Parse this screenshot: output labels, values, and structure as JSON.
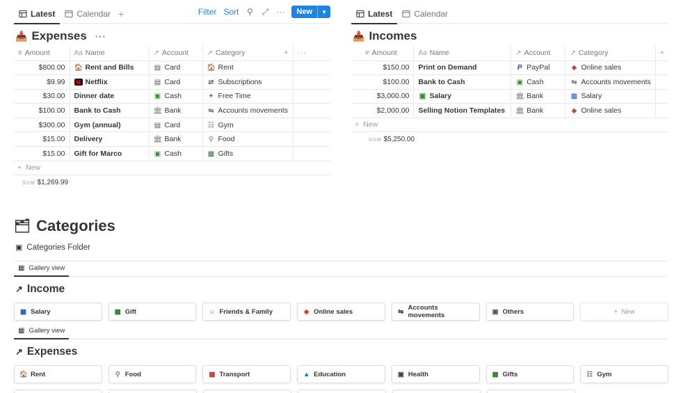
{
  "left_panel": {
    "tabs": [
      {
        "label": "Latest"
      },
      {
        "label": "Calendar"
      }
    ],
    "toolbar": {
      "filter": "Filter",
      "sort": "Sort",
      "new": "New"
    },
    "title": "Expenses",
    "columns": {
      "amount": "Amount",
      "name": "Name",
      "account": "Account",
      "category": "Category"
    },
    "rows": [
      {
        "amount": "$800.00",
        "name": "Rent and Bills",
        "name_icon": "house-icon",
        "account": "Card",
        "account_icon": "card-icon",
        "category": "Rent",
        "category_icon": "house-icon"
      },
      {
        "amount": "$9.99",
        "name": "Netflix",
        "name_icon": "netflix-icon",
        "account": "Card",
        "account_icon": "card-icon",
        "category": "Subscriptions",
        "category_icon": "repeat-icon"
      },
      {
        "amount": "$30.00",
        "name": "Dinner date",
        "name_icon": "",
        "account": "Cash",
        "account_icon": "cash-icon",
        "category": "Free Time",
        "category_icon": "confetti-icon"
      },
      {
        "amount": "$100.00",
        "name": "Bank to Cash",
        "name_icon": "",
        "account": "Bank",
        "account_icon": "bank-icon",
        "category": "Accounts movements",
        "category_icon": "exchange-icon"
      },
      {
        "amount": "$300.00",
        "name": "Gym (annual)",
        "name_icon": "",
        "account": "Card",
        "account_icon": "card-icon",
        "category": "Gym",
        "category_icon": "dumbbell-icon"
      },
      {
        "amount": "$15.00",
        "name": "Delivery",
        "name_icon": "",
        "account": "Bank",
        "account_icon": "bank-icon",
        "category": "Food",
        "category_icon": "fork-knife-icon"
      },
      {
        "amount": "$15.00",
        "name": "Gift for Marco",
        "name_icon": "",
        "account": "Cash",
        "account_icon": "cash-icon",
        "category": "Gifts",
        "category_icon": "gift-icon"
      }
    ],
    "new_row": "New",
    "sum_label": "SUM",
    "sum_value": "$1,269.99"
  },
  "right_panel": {
    "tabs": [
      {
        "label": "Latest"
      },
      {
        "label": "Calendar"
      }
    ],
    "title": "Incomes",
    "columns": {
      "amount": "Amount",
      "name": "Name",
      "account": "Account",
      "category": "Category"
    },
    "rows": [
      {
        "amount": "$150.00",
        "name": "Print on Demand",
        "name_icon": "",
        "account": "PayPal",
        "account_icon": "paypal-icon",
        "category": "Online sales",
        "category_icon": "tag-icon"
      },
      {
        "amount": "$100.00",
        "name": "Bank to Cash",
        "name_icon": "",
        "account": "Cash",
        "account_icon": "cash-icon",
        "category": "Accounts movements",
        "category_icon": "exchange-icon"
      },
      {
        "amount": "$3,000.00",
        "name": "Salary",
        "name_icon": "cash-icon",
        "account": "Bank",
        "account_icon": "bank-icon",
        "category": "Salary",
        "category_icon": "briefcase-icon"
      },
      {
        "amount": "$2,000.00",
        "name": "Selling Notion Templates",
        "name_icon": "",
        "account": "Bank",
        "account_icon": "bank-icon",
        "category": "Online sales",
        "category_icon": "tag-icon"
      }
    ],
    "new_row": "New",
    "sum_label": "SUM",
    "sum_value": "$5,250.00"
  },
  "categories": {
    "title": "Categories",
    "folder": "Categories Folder",
    "gallery_view": "Gallery view",
    "income": {
      "title": "Income",
      "cards": [
        {
          "label": "Salary",
          "icon": "briefcase-icon"
        },
        {
          "label": "Gift",
          "icon": "gift-icon"
        },
        {
          "label": "Friends & Family",
          "icon": "people-icon"
        },
        {
          "label": "Online sales",
          "icon": "tag-icon"
        },
        {
          "label": "Accounts movements",
          "icon": "exchange-icon"
        },
        {
          "label": "Others",
          "icon": "box-icon"
        }
      ],
      "new_card": "New"
    },
    "expenses": {
      "title": "Expenses",
      "cards": [
        {
          "label": "Rent",
          "icon": "house-icon"
        },
        {
          "label": "Food",
          "icon": "fork-knife-icon"
        },
        {
          "label": "Transport",
          "icon": "bus-icon"
        },
        {
          "label": "Education",
          "icon": "grad-cap-icon"
        },
        {
          "label": "Health",
          "icon": "medkit-icon"
        },
        {
          "label": "Gifts",
          "icon": "gift-icon"
        },
        {
          "label": "Gym",
          "icon": "dumbbell-icon"
        }
      ]
    }
  }
}
